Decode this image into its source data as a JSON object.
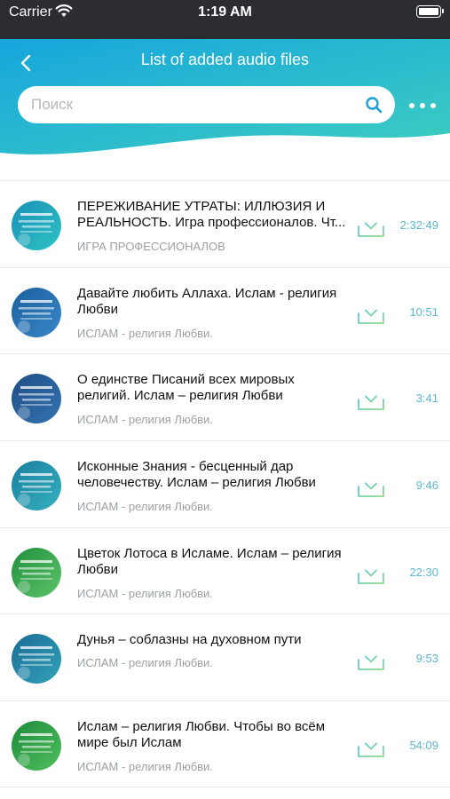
{
  "status_bar": {
    "carrier": "Carrier",
    "time": "1:19 AM"
  },
  "header": {
    "title": "List of added audio files"
  },
  "search": {
    "placeholder": "Поиск",
    "value": ""
  },
  "colors": {
    "header_gradient_start": "#16a6dd",
    "header_gradient_end": "#3ecdc0",
    "duration": "#5cb8d0",
    "download_start": "#55c6d9",
    "download_end": "#8fd88a"
  },
  "items": [
    {
      "title": "ПЕРЕЖИВАНИЕ УТРАТЫ: ИЛЛЮЗИЯ И РЕАЛЬНОСТЬ. Игра профессионалов. Чт...",
      "subtitle": "ИГРА ПРОФЕССИОНАЛОВ",
      "duration": "2:32:49",
      "thumb_text": "ПЕРЕЖИВАНИЕ УТРАТЫ",
      "thumb_icon": "cover-image-icon"
    },
    {
      "title": "Давайте любить Аллаха. Ислам - религия Любви",
      "subtitle": "ИСЛАМ - религия Любви.",
      "duration": "10:51",
      "thumb_text": "ДАВАЙТЕ ЛЮБИТЬ",
      "thumb_icon": "cover-image-icon"
    },
    {
      "title": "О единстве Писаний всех мировых религий. Ислам – религия Любви",
      "subtitle": "ИСЛАМ - религия Любви.",
      "duration": "3:41",
      "thumb_text": "О ЕДИНСТВЕ",
      "thumb_icon": "cover-image-icon"
    },
    {
      "title": "Исконные Знания - бесценный дар человечеству. Ислам – религия Любви",
      "subtitle": "ИСЛАМ - религия Любви.",
      "duration": "9:46",
      "thumb_text": "ИСКОННЫЕ",
      "thumb_icon": "cover-image-icon"
    },
    {
      "title": "Цветок Лотоса в Исламе. Ислам – религия Любви",
      "subtitle": "ИСЛАМ - религия Любви.",
      "duration": "22:30",
      "thumb_text": "ЦВЕТОК ЛОТОСА",
      "thumb_icon": "cover-image-icon"
    },
    {
      "title": "Дунья – соблазны на духовном пути",
      "subtitle": "ИСЛАМ - религия Любви.",
      "duration": "9:53",
      "thumb_text": "ДУНЬЯ",
      "thumb_icon": "cover-image-icon"
    },
    {
      "title": "Ислам – религия Любви. Чтобы во всём мире был Ислам",
      "subtitle": "ИСЛАМ - религия Любви.",
      "duration": "54:09",
      "thumb_text": "ИСЛАМ",
      "thumb_icon": "cover-image-icon"
    }
  ]
}
